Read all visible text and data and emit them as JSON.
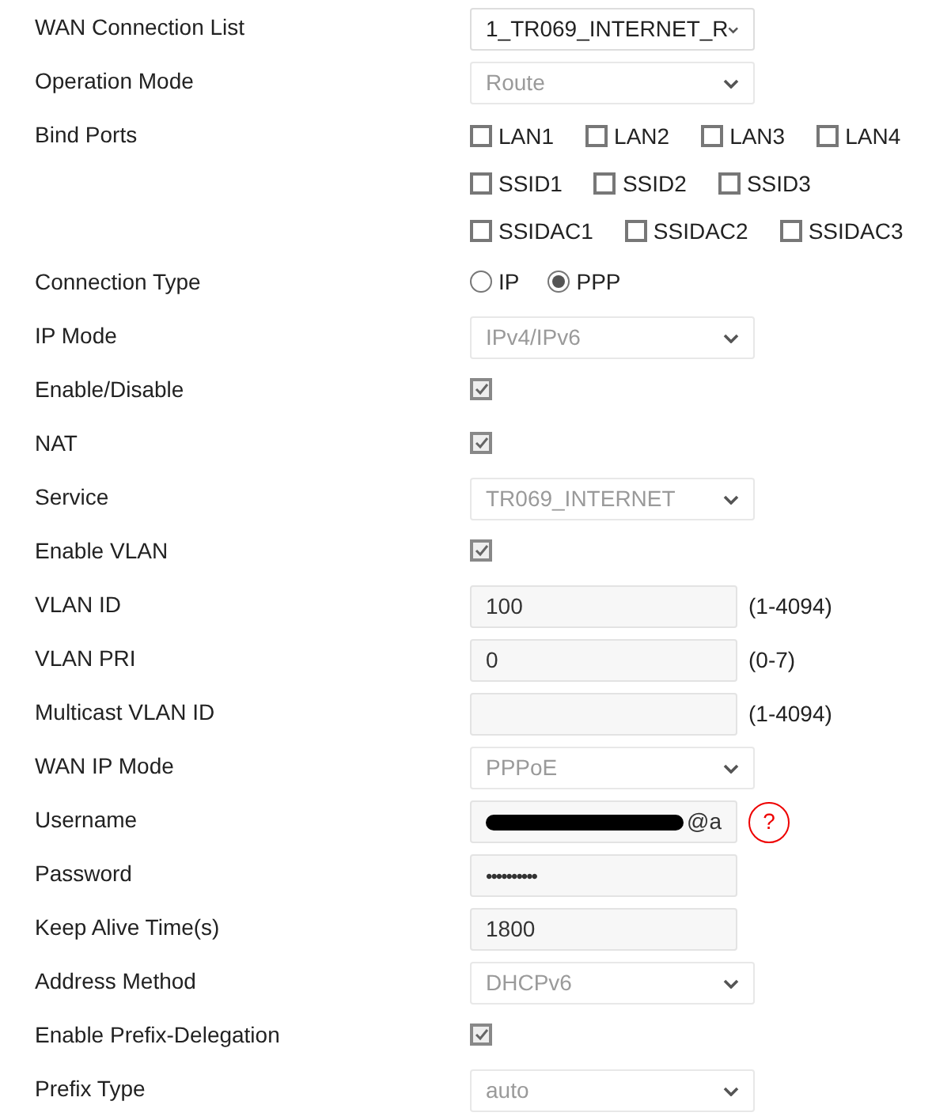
{
  "rows": [
    {
      "kind": "select",
      "label": "WAN Connection List",
      "value": "1_TR069_INTERNET_R",
      "disabled": false
    },
    {
      "kind": "select",
      "label": "Operation Mode",
      "value": "Route",
      "disabled": true
    },
    {
      "kind": "checkgroup",
      "label": "Bind Ports",
      "lines": [
        [
          {
            "label": "LAN1",
            "checked": false
          },
          {
            "label": "LAN2",
            "checked": false
          },
          {
            "label": "LAN3",
            "checked": false
          },
          {
            "label": "LAN4",
            "checked": false
          }
        ],
        [
          {
            "label": "SSID1",
            "checked": false
          },
          {
            "label": "SSID2",
            "checked": false
          },
          {
            "label": "SSID3",
            "checked": false
          }
        ],
        [
          {
            "label": "SSIDAC1",
            "checked": false
          },
          {
            "label": "SSIDAC2",
            "checked": false
          },
          {
            "label": "SSIDAC3",
            "checked": false
          }
        ]
      ]
    },
    {
      "kind": "radio",
      "label": "Connection Type",
      "options": [
        {
          "label": "IP",
          "selected": false
        },
        {
          "label": "PPP",
          "selected": true
        }
      ]
    },
    {
      "kind": "select",
      "label": "IP Mode",
      "value": "IPv4/IPv6",
      "disabled": true
    },
    {
      "kind": "checkbox",
      "label": "Enable/Disable",
      "checked": true
    },
    {
      "kind": "checkbox",
      "label": "NAT",
      "checked": true
    },
    {
      "kind": "select",
      "label": "Service",
      "value": "TR069_INTERNET",
      "disabled": true
    },
    {
      "kind": "checkbox",
      "label": "Enable VLAN",
      "checked": true
    },
    {
      "kind": "input",
      "label": "VLAN ID",
      "value": "100",
      "hint": "(1-4094)"
    },
    {
      "kind": "input",
      "label": "VLAN PRI",
      "value": "0",
      "hint": "(0-7)"
    },
    {
      "kind": "input",
      "label": "Multicast VLAN ID",
      "hint": "(1-4094)"
    },
    {
      "kind": "select",
      "label": "WAN IP Mode",
      "value": "PPPoE",
      "disabled": true
    },
    {
      "kind": "username",
      "label": "Username",
      "value": "@a",
      "redacted": true,
      "help": "?"
    },
    {
      "kind": "password",
      "label": "Password",
      "value": "••••••••••"
    },
    {
      "kind": "input",
      "label": "Keep Alive Time(s)",
      "value": "1800"
    },
    {
      "kind": "select",
      "label": "Address Method",
      "value": "DHCPv6",
      "disabled": true
    },
    {
      "kind": "checkbox",
      "label": "Enable Prefix-Delegation",
      "checked": true
    },
    {
      "kind": "select",
      "label": "Prefix Type",
      "value": "auto",
      "disabled": true
    }
  ]
}
